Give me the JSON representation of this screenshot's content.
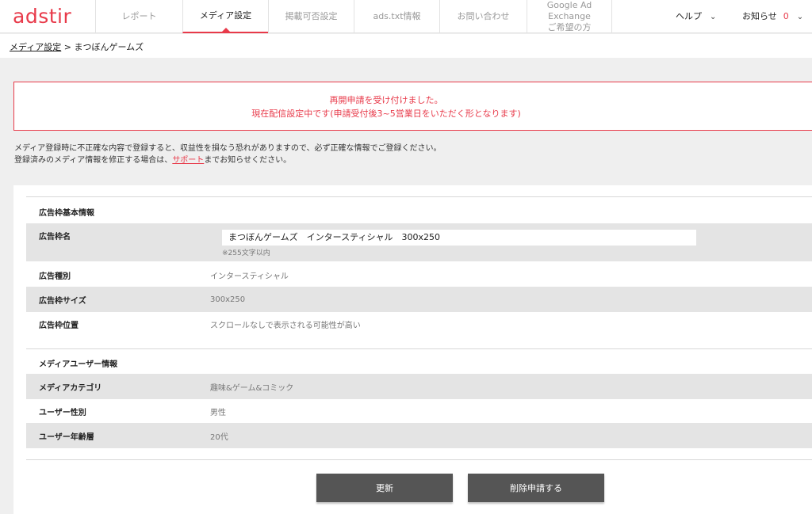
{
  "brand": {
    "logo": "adstir",
    "accent": "#e83a4a"
  },
  "nav": {
    "items": [
      {
        "label": "レポート",
        "active": false
      },
      {
        "label": "メディア設定",
        "active": true
      },
      {
        "label": "掲載可否設定",
        "active": false
      },
      {
        "label": "ads.txt情報",
        "active": false
      },
      {
        "label": "お問い合わせ",
        "active": false
      },
      {
        "label_line1": "Google Ad Exchange",
        "label_line2": "ご希望の方",
        "active": false
      }
    ],
    "help": "ヘルプ",
    "notice": "お知らせ",
    "notice_count": "0"
  },
  "breadcrumb": {
    "parent": "メディア設定",
    "separator": " > ",
    "current": "まつぼんゲームズ"
  },
  "alert": {
    "line1": "再開申請を受け付けました。",
    "line2": "現在配信設定中です(申請受付後3~5営業日をいただく形となります)"
  },
  "description": {
    "line1": "メディア登録時に不正確な内容で登録すると、収益性を損なう恐れがありますので、必ず正確な情報でご登録ください。",
    "line2_pre": "登録済みのメディア情報を修正する場合は、",
    "line2_link": "サポート",
    "line2_post": "までお知らせください。"
  },
  "ad_basic": {
    "title": "広告枠基本情報",
    "name_label": "広告枠名",
    "name_value": "まつぼんゲームズ　インタースティシャル　300x250",
    "name_hint": "※255文字以内",
    "type_label": "広告種別",
    "type_value": "インタースティシャル",
    "size_label": "広告枠サイズ",
    "size_value": "300x250",
    "position_label": "広告枠位置",
    "position_value": "スクロールなしで表示される可能性が高い"
  },
  "media_user": {
    "title": "メディアユーザー情報",
    "category_label": "メディアカテゴリ",
    "category_value": "趣味&ゲーム&コミック",
    "gender_label": "ユーザー性別",
    "gender_value": "男性",
    "age_label": "ユーザー年齢層",
    "age_value": "20代"
  },
  "buttons": {
    "update": "更新",
    "delete_request": "削除申請する"
  }
}
